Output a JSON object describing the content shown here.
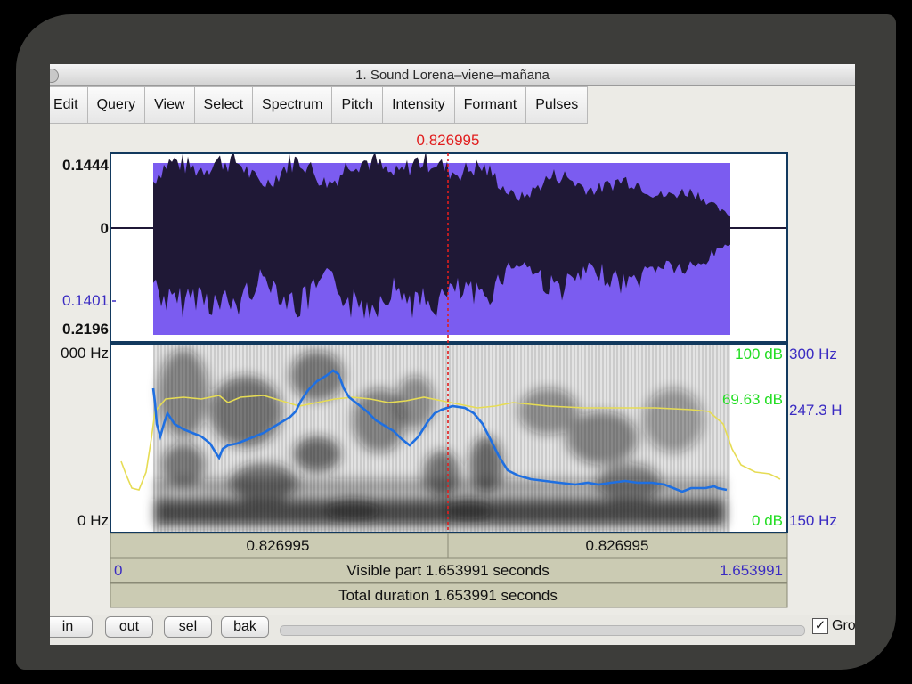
{
  "window": {
    "title": "1. Sound Lorena–viene–mañana"
  },
  "menu": [
    "Edit",
    "Query",
    "View",
    "Select",
    "Spectrum",
    "Pitch",
    "Intensity",
    "Formant",
    "Pulses"
  ],
  "cursor": {
    "time_label": "0.826995",
    "color": "#e11d1d"
  },
  "waveform": {
    "top_label": "0.1444",
    "zero_label": "0",
    "selection_label": "0.1401",
    "bottom_label": "0.2196",
    "selection_color": "#7b5cf0",
    "wave_color": "#1f1836"
  },
  "spectrogram": {
    "freq_top_label": "000 Hz",
    "freq_bottom_label": "0 Hz",
    "intensity_top_label": "100 dB",
    "intensity_current_label": "69.63 dB",
    "intensity_bottom_label": "0 dB",
    "pitch_top_label": "300 Hz",
    "pitch_current_label": "247.3 H",
    "pitch_bottom_label": "150 Hz",
    "pitch_color": "#1f6fe0",
    "intensity_color": "#e6dc54",
    "db_label_color": "#22dd22",
    "hz_label_color": "#3a2bc2"
  },
  "info": {
    "left_time": "0.826995",
    "right_time": "0.826995",
    "visible_start": "0",
    "visible_text": "Visible part 1.653991 seconds",
    "visible_end": "1.653991",
    "total_text": "Total duration 1.653991 seconds",
    "bar_color": "#cbcbb3"
  },
  "zoom_buttons": [
    "in",
    "out",
    "sel",
    "bak"
  ],
  "group_checkbox": {
    "checked": "✓",
    "label": "Gro"
  }
}
